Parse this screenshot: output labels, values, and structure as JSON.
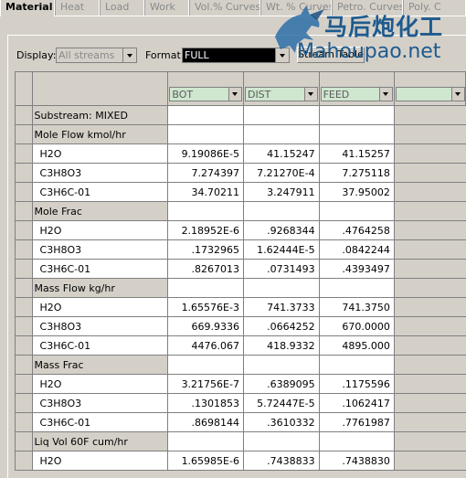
{
  "tabs": [
    "Material",
    "Heat",
    "Load",
    "Work",
    "Vol.% Curves",
    "Wt. % Curves",
    "Petro. Curves",
    "Poly. C"
  ],
  "display": {
    "label": "Display:",
    "value": "All streams"
  },
  "format": {
    "label": "Format:",
    "value": "FULL"
  },
  "stream_table_button": "Stream Table",
  "columns": [
    "BOT",
    "DIST",
    "FEED",
    ""
  ],
  "rows": [
    {
      "label": "Substream: MIXED",
      "type": "section",
      "values": [
        "",
        "",
        "",
        ""
      ]
    },
    {
      "label": "Mole Flow kmol/hr",
      "type": "section",
      "values": [
        "",
        "",
        "",
        ""
      ]
    },
    {
      "label": "H2O",
      "type": "sub",
      "values": [
        "9.19086E-5",
        "41.15247",
        "41.15257",
        ""
      ]
    },
    {
      "label": "C3H8O3",
      "type": "sub",
      "values": [
        "7.274397",
        "7.21270E-4",
        "7.275118",
        ""
      ]
    },
    {
      "label": "C3H6C-01",
      "type": "sub",
      "values": [
        "34.70211",
        "3.247911",
        "37.95002",
        ""
      ]
    },
    {
      "label": "Mole Frac",
      "type": "section",
      "values": [
        "",
        "",
        "",
        ""
      ]
    },
    {
      "label": "H2O",
      "type": "sub",
      "values": [
        "2.18952E-6",
        ".9268344",
        ".4764258",
        ""
      ]
    },
    {
      "label": "C3H8O3",
      "type": "sub",
      "values": [
        ".1732965",
        "1.62444E-5",
        ".0842244",
        ""
      ]
    },
    {
      "label": "C3H6C-01",
      "type": "sub",
      "values": [
        ".8267013",
        ".0731493",
        ".4393497",
        ""
      ]
    },
    {
      "label": "Mass Flow kg/hr",
      "type": "section",
      "values": [
        "",
        "",
        "",
        ""
      ]
    },
    {
      "label": "H2O",
      "type": "sub",
      "values": [
        "1.65576E-3",
        "741.3733",
        "741.3750",
        ""
      ]
    },
    {
      "label": "C3H8O3",
      "type": "sub",
      "values": [
        "669.9336",
        ".0664252",
        "670.0000",
        ""
      ]
    },
    {
      "label": "C3H6C-01",
      "type": "sub",
      "values": [
        "4476.067",
        "418.9332",
        "4895.000",
        ""
      ]
    },
    {
      "label": "Mass Frac",
      "type": "section",
      "values": [
        "",
        "",
        "",
        ""
      ]
    },
    {
      "label": "H2O",
      "type": "sub",
      "values": [
        "3.21756E-7",
        ".6389095",
        ".1175596",
        ""
      ]
    },
    {
      "label": "C3H8O3",
      "type": "sub",
      "values": [
        ".1301853",
        "5.72447E-5",
        ".1062417",
        ""
      ]
    },
    {
      "label": "C3H6C-01",
      "type": "sub",
      "values": [
        ".8698144",
        ".3610332",
        ".7761987",
        ""
      ]
    },
    {
      "label": "Liq Vol 60F cum/hr",
      "type": "section",
      "values": [
        "",
        "",
        "",
        ""
      ]
    },
    {
      "label": "H2O",
      "type": "sub",
      "values": [
        "1.65985E-6",
        ".7438833",
        ".7438830",
        ""
      ]
    }
  ],
  "watermark": {
    "line1": "马后炮化工",
    "line2": "Mahoupao.net"
  }
}
